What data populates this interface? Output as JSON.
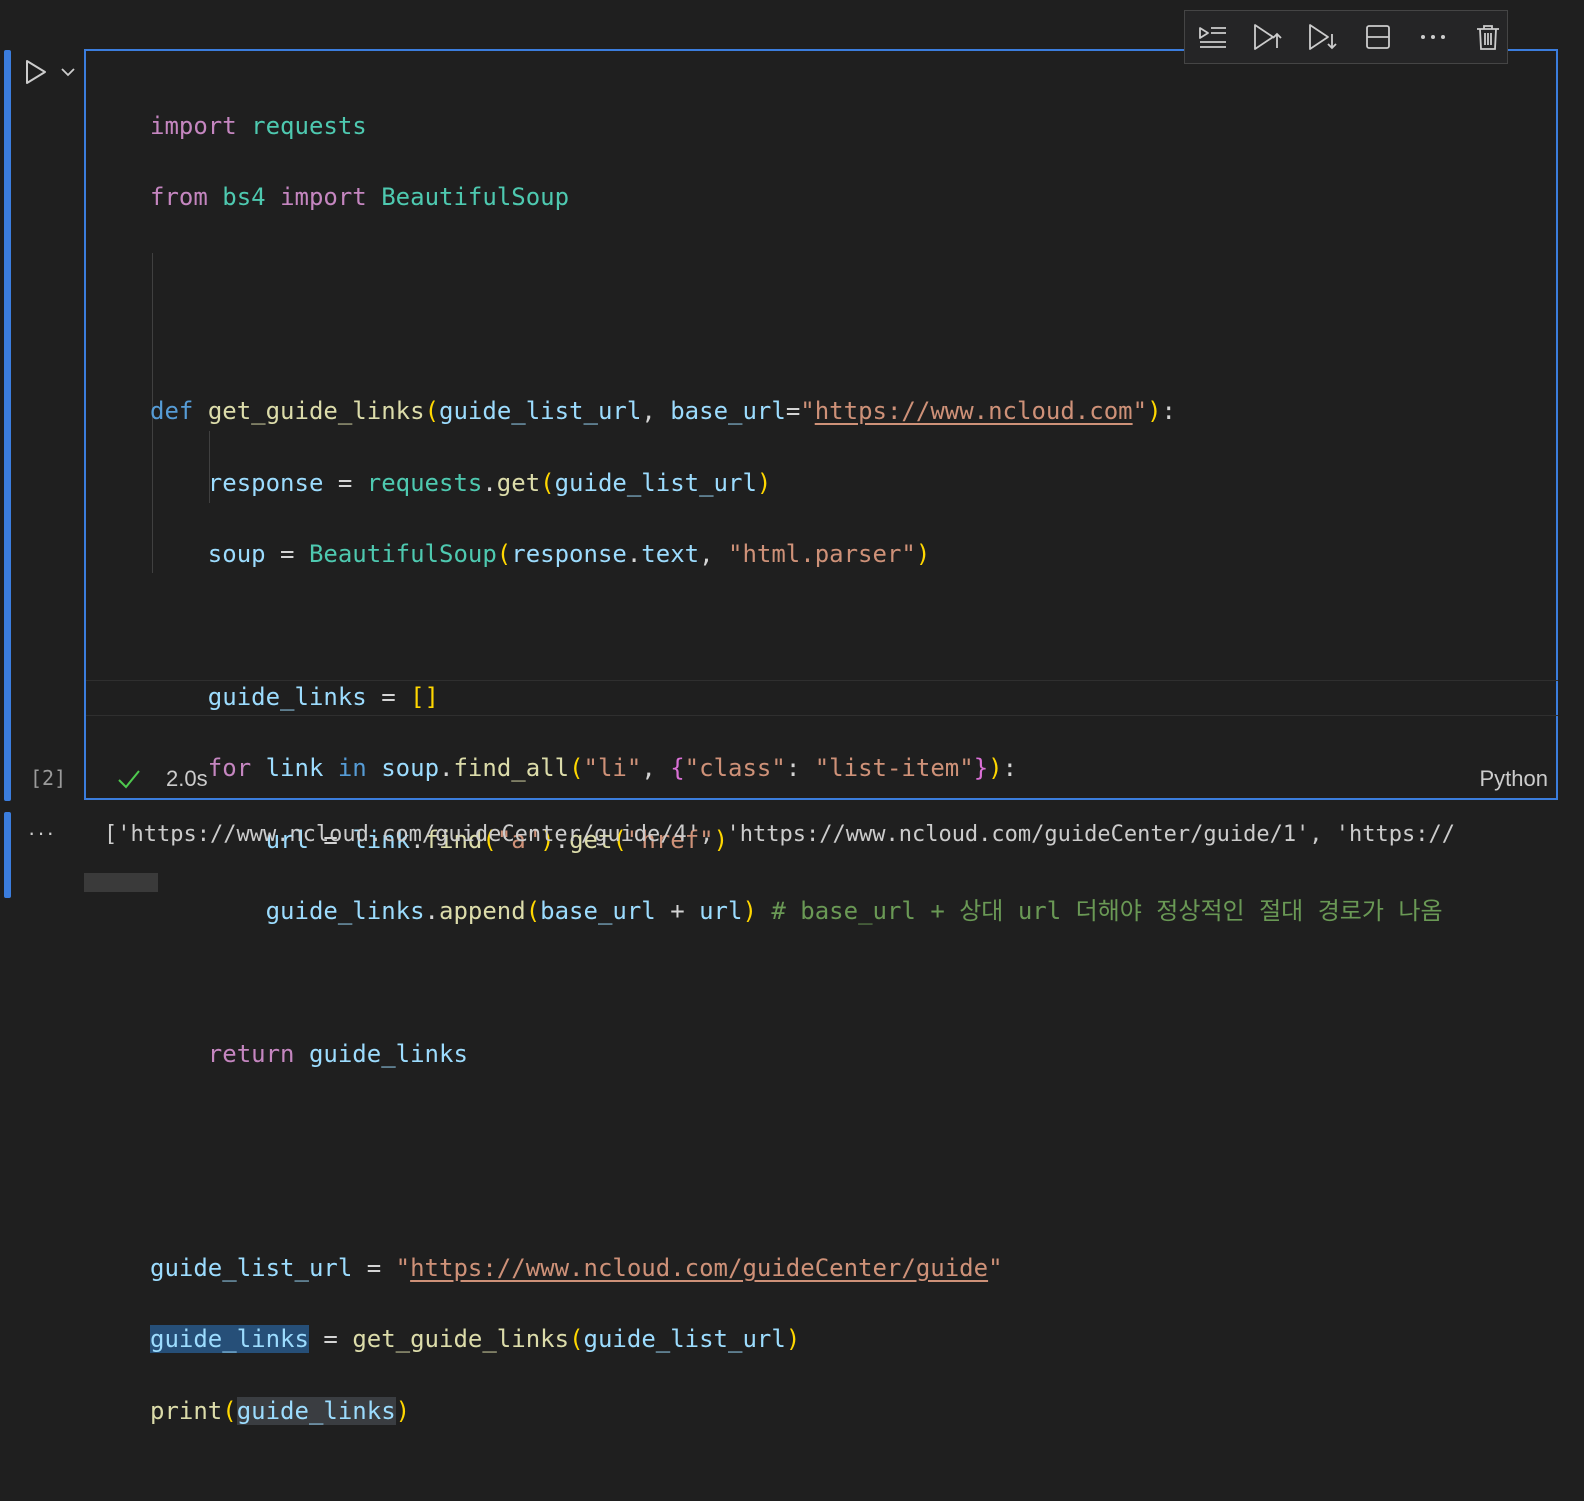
{
  "cell": {
    "exec_count": "[2]",
    "status_time": "2.0s",
    "language": "Python",
    "output_more": "···",
    "output_text": "['https://www.ncloud.com/guideCenter/guide/4', 'https://www.ncloud.com/guideCenter/guide/1', 'https://"
  },
  "toolbar": {
    "icons": [
      "execute-above-icon",
      "run-above-icon",
      "run-below-icon",
      "split-cell-icon",
      "more-icon",
      "delete-icon"
    ]
  },
  "code": {
    "l1": {
      "k": "import",
      "m": "requests"
    },
    "l2": {
      "k1": "from",
      "m": "bs4",
      "k2": "import",
      "c": "BeautifulSoup"
    },
    "l5": {
      "def": "def",
      "fn": "get_guide_links",
      "p1": "guide_list_url",
      "comma": ", ",
      "p2": "base_url",
      "eq": "=",
      "q": "\"",
      "url": "https://www.ncloud.com",
      "end": ":"
    },
    "l6": {
      "v": "response",
      "eq": " = ",
      "mod": "requests",
      "dot": ".",
      "fn": "get",
      "arg": "guide_list_url"
    },
    "l7": {
      "v": "soup",
      "eq": " = ",
      "cls": "BeautifulSoup",
      "a1": "response",
      "dot": ".",
      "a2": "text",
      "comma": ", ",
      "s": "\"html.parser\""
    },
    "l9": {
      "v": "guide_links",
      "eq": " = ",
      "br": "[]"
    },
    "l10": {
      "k1": "for",
      "v": "link",
      "k2": "in",
      "obj": "soup",
      "dot": ".",
      "fn": "find_all",
      "s1": "\"li\"",
      "comma": ", ",
      "s2": "\"class\"",
      "colon": ": ",
      "s3": "\"list-item\"",
      "end": ":"
    },
    "l11": {
      "v": "url",
      "eq": " = ",
      "obj": "link",
      "dot": ".",
      "fn1": "find",
      "s1": "\"a\"",
      "fn2": "get",
      "s2": "\"href\""
    },
    "l12": {
      "obj": "guide_links",
      "dot": ".",
      "fn": "append",
      "a1": "base_url",
      "plus": " + ",
      "a2": "url",
      "cmt": "# base_url + 상대 url 더해야 정상적인 절대 경로가 나옴"
    },
    "l14": {
      "k": "return",
      "v": "guide_links"
    },
    "l17": {
      "v": "guide_list_url",
      "eq": " = ",
      "q": "\"",
      "url": "https://www.ncloud.com/guideCenter/guide"
    },
    "l18": {
      "v": "guide_links",
      "eq": " = ",
      "fn": "get_guide_links",
      "arg": "guide_list_url"
    },
    "l19": {
      "fn": "print",
      "arg": "guide_links"
    }
  },
  "colors": {
    "accent": "#3b7ddd",
    "background": "#1f1f1f",
    "keyword": "#c586c0",
    "function": "#dcdcaa",
    "variable": "#9cdcfe",
    "class": "#4ec9b0",
    "string": "#ce9178",
    "comment": "#6a9955"
  }
}
